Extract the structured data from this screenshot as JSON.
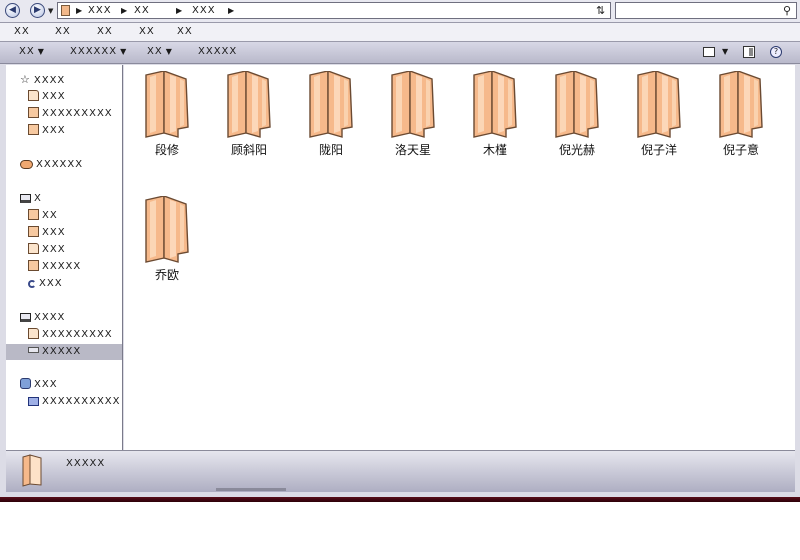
{
  "address_bar": {
    "crumbs": [
      "XXX",
      "XX",
      "XXX"
    ],
    "search_placeholder": ""
  },
  "menu": {
    "items": [
      "XX",
      "XX",
      "XX",
      "XX",
      "XX"
    ]
  },
  "toolbar": {
    "organize": "XX",
    "include": "XXXXXX",
    "share": "XX",
    "new_folder": "XXXXX"
  },
  "navigation": {
    "favorites": {
      "label": "XXXX",
      "items": [
        "XXX",
        "XXXXXXXXX",
        "XXX"
      ]
    },
    "cloud": {
      "label": "XXXXXX"
    },
    "libraries": {
      "label": "X",
      "items": [
        "XX",
        "XXX",
        "XXX",
        "XXXXX",
        "XXX"
      ]
    },
    "computer": {
      "label": "XXXX",
      "items": [
        "XXXXXXXXX",
        "XXXXX"
      ],
      "selected": "XXXXX"
    },
    "network": {
      "label": "XXX",
      "items": [
        "XXXXXXXXXX"
      ]
    }
  },
  "folders": [
    "段修",
    "顾斜阳",
    "陇阳",
    "洛天星",
    "木槿",
    "倪光赫",
    "倪子洋",
    "倪子意",
    "乔欧"
  ],
  "details": {
    "label": "XXXXX"
  },
  "colors": {
    "folder_fill": "#f6b98b",
    "folder_light": "#fde2c8",
    "folder_outline": "#6b4a32",
    "chrome": "#dcdce6",
    "selection": "#b9b9c6"
  }
}
